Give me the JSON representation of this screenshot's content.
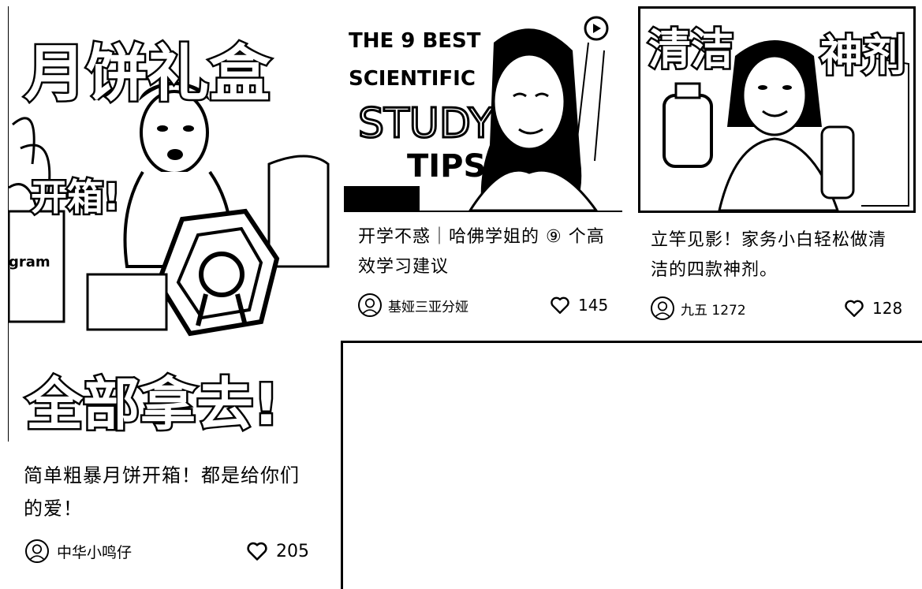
{
  "feed": {
    "cards": [
      {
        "title": "简单粗暴月饼开箱！都是给你们的爱！",
        "thumb_overlay": {
          "top": "月饼礼盒",
          "middle": "开箱!",
          "bottom": "全部拿去!",
          "side": "gram"
        },
        "author": "中华小鸣仔",
        "likes": "205"
      },
      {
        "title": "开学不惑｜哈佛学姐的 ⑨ 个高效学习建议",
        "thumb_overlay": {
          "line1": "THE 9 BEST",
          "line2": "SCIENTIFIC",
          "line3": "STUDY",
          "line4": "TIPS"
        },
        "author": "基娅三亚分娅",
        "likes": "145"
      },
      {
        "title": "立竿见影！家务小白轻松做清洁的四款神剂。",
        "thumb_overlay": {
          "left": "清洁",
          "right": "神剂"
        },
        "author": "九五 1272",
        "likes": "128"
      }
    ]
  },
  "icons": {
    "like": "heart-icon",
    "avatar": "avatar-icon"
  },
  "colors": {
    "ink": "#000000",
    "paper": "#ffffff"
  }
}
